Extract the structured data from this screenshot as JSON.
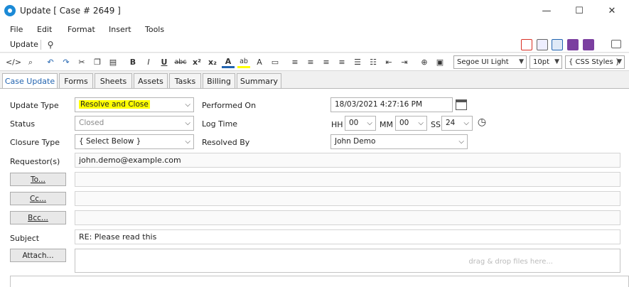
{
  "window": {
    "title": "Update [ Case # 2649 ]",
    "minimize_glyph": "—",
    "maximize_glyph": "☐",
    "close_glyph": "✕"
  },
  "menu": [
    "File",
    "Edit",
    "Format",
    "Insert",
    "Tools"
  ],
  "toolbar": {
    "update_label": "Update",
    "font_name": "Segoe UI Light",
    "font_size": "10pt",
    "css_styles": "{ CSS Styles }"
  },
  "tabs": [
    "Case Update",
    "Forms",
    "Sheets",
    "Assets",
    "Tasks",
    "Billing",
    "Summary"
  ],
  "form": {
    "update_type_label": "Update Type",
    "update_type_value": "Resolve and Close",
    "status_label": "Status",
    "status_value": "Closed",
    "closure_type_label": "Closure Type",
    "closure_type_value": "{ Select Below }",
    "requestors_label": "Requestor(s)",
    "requestors_value": "john.demo@example.com",
    "performed_on_label": "Performed On",
    "performed_on_value": "18/03/2021 4:27:16 PM",
    "log_time_label": "Log Time",
    "hh_label": "HH",
    "hh_value": "00",
    "mm_label": "MM",
    "mm_value": "00",
    "ss_label": "SS",
    "ss_value": "24",
    "resolved_by_label": "Resolved By",
    "resolved_by_value": "John Demo",
    "to_button": "To...",
    "cc_button": "Cc...",
    "bcc_button": "Bcc...",
    "subject_label": "Subject",
    "subject_value": "RE: Please read this",
    "attach_button": "Attach...",
    "dropzone_hint": "drag & drop files here..."
  },
  "colors": {
    "accent": "#2264b0",
    "highlight": "#ffff00",
    "pdf": "#d93025",
    "help": "#7b3fa0"
  }
}
